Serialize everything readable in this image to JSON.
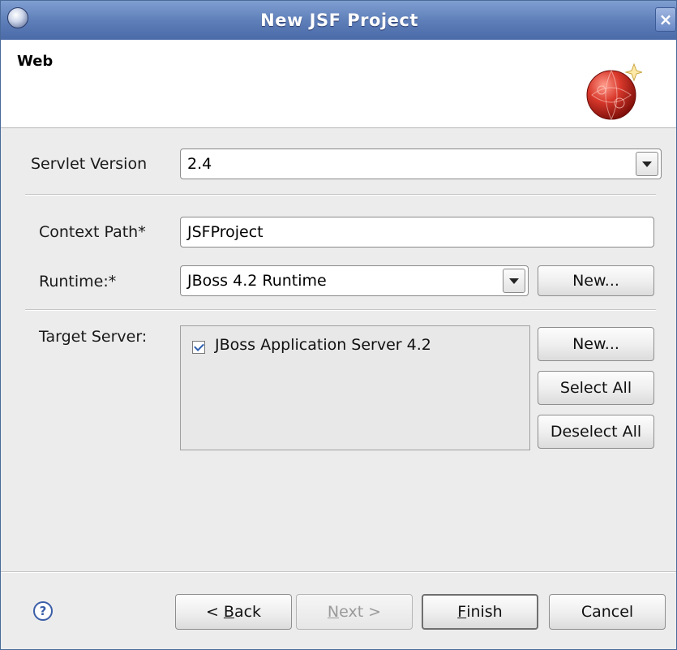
{
  "window": {
    "title": "New JSF Project",
    "close_glyph": "×"
  },
  "header": {
    "title": "Web",
    "icon": "wizard-globe-icon"
  },
  "servlet_version": {
    "label": "Servlet Version",
    "value": "2.4"
  },
  "context_path": {
    "label": "Context Path*",
    "value": "JSFProject"
  },
  "runtime": {
    "label": "Runtime:*",
    "value": "JBoss 4.2 Runtime",
    "new_button": "New..."
  },
  "target_server": {
    "label": "Target Server:",
    "items": [
      {
        "label": "JBoss Application Server 4.2",
        "checked": true
      }
    ],
    "new_button": "New...",
    "select_all_button": "Select All",
    "deselect_all_button": "Deselect All"
  },
  "footer": {
    "help_glyph": "?",
    "back": {
      "prefix": "< ",
      "mnemonic": "B",
      "rest": "ack"
    },
    "next": {
      "mnemonic": "N",
      "rest": "ext >"
    },
    "finish": {
      "mnemonic": "F",
      "rest": "inish"
    },
    "cancel": "Cancel"
  }
}
